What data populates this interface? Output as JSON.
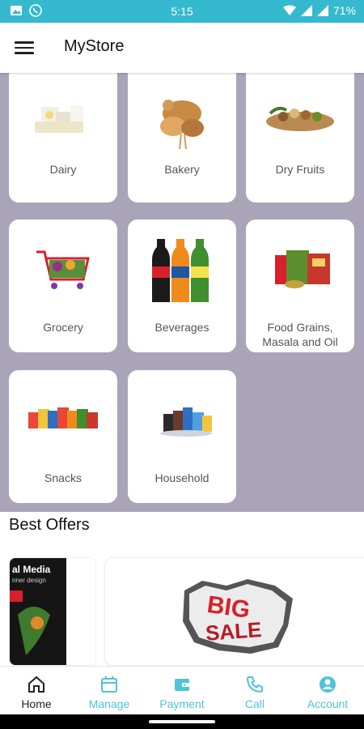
{
  "status_bar": {
    "time": "5:15",
    "battery": "71%"
  },
  "app_bar": {
    "title": "MyStore"
  },
  "categories": [
    {
      "label": "Dairy"
    },
    {
      "label": "Bakery"
    },
    {
      "label": "Dry Fruits"
    },
    {
      "label": "Grocery"
    },
    {
      "label": "Beverages"
    },
    {
      "label": "Food Grains,\nMasala and Oil"
    },
    {
      "label": "Snacks"
    },
    {
      "label": "Household"
    }
  ],
  "offers": {
    "title": "Best Offers",
    "left_banner_text_1": "al Media",
    "left_banner_text_2": "nner design",
    "main_banner_text_1": "BIG",
    "main_banner_text_2": "SALE"
  },
  "bottom_nav": [
    {
      "label": "Home",
      "icon": "home-icon"
    },
    {
      "label": "Manage",
      "icon": "calendar-icon"
    },
    {
      "label": "Payment",
      "icon": "wallet-icon"
    },
    {
      "label": "Call",
      "icon": "phone-icon"
    },
    {
      "label": "Account",
      "icon": "account-icon"
    }
  ],
  "colors": {
    "status_bar": "#35b9cf",
    "grid_bg": "#a9a4b8",
    "nav_accent": "#4fc3d7",
    "sale_red": "#d8202a"
  }
}
